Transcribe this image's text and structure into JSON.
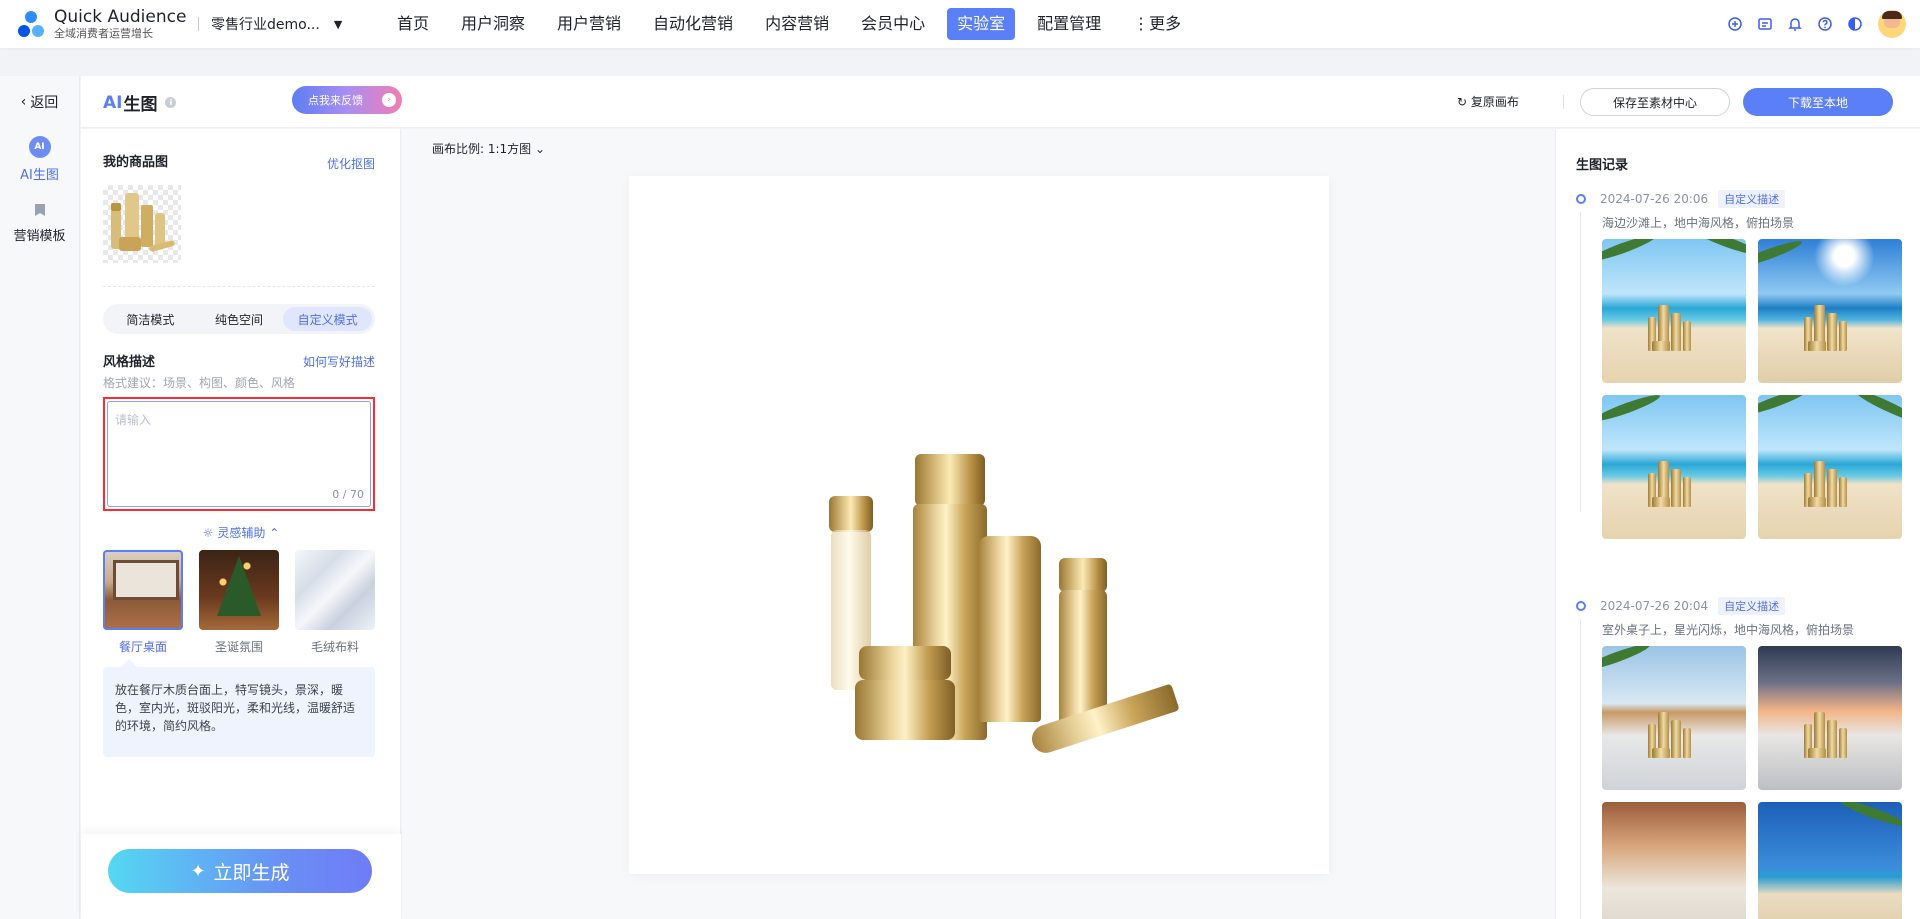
{
  "app": {
    "name": "Quick Audience",
    "tagline": "全域消费者运营增长",
    "workspace": "零售行业demo..."
  },
  "nav": {
    "items": [
      "首页",
      "用户洞察",
      "用户营销",
      "自动化营销",
      "内容营销",
      "会员中心",
      "实验室",
      "配置管理",
      "⋮更多"
    ],
    "active": "实验室"
  },
  "rail": {
    "back_label": "返回",
    "items": [
      {
        "label": "AI生图",
        "icon": "ai-icon",
        "icon_text": "AI",
        "active": true
      },
      {
        "label": "营销模板",
        "icon": "bookmark-icon",
        "active": false
      }
    ]
  },
  "header": {
    "title_ai": "AI",
    "title_rest": "生图",
    "feedback": "点我来反馈",
    "restore": "复原画布",
    "save": "保存至素材中心",
    "download": "下载至本地"
  },
  "panel": {
    "product_title": "我的商品图",
    "optimize_link": "优化抠图",
    "modes": [
      "简洁模式",
      "纯色空间",
      "自定义模式"
    ],
    "active_mode": "自定义模式",
    "style_title": "风格描述",
    "style_link": "如何写好描述",
    "hint": "格式建议：场景、构图、颜色、风格",
    "input_placeholder": "请输入",
    "counter": "0 / 70",
    "inspire": "灵感辅助",
    "style_cards": [
      {
        "label": "餐厅桌面",
        "active": true
      },
      {
        "label": "圣诞氛围",
        "active": false
      },
      {
        "label": "毛绒布料",
        "active": false
      }
    ],
    "style_desc": "放在餐厅木质台面上，特写镜头，景深，暖色，室内光，斑驳阳光，柔和光线，温暖舒适的环境，简约风格。",
    "generate": "立即生成"
  },
  "canvas": {
    "ratio_label": "画布比例: 1:1方图"
  },
  "history": {
    "title": "生图记录",
    "records": [
      {
        "time": "2024-07-26 20:06",
        "tag": "自定义描述",
        "desc": "海边沙滩上，地中海风格，俯拍场景"
      },
      {
        "time": "2024-07-26 20:04",
        "tag": "自定义描述",
        "desc": "室外桌子上，星光闪烁，地中海风格，俯拍场景"
      }
    ]
  },
  "colors": {
    "accent": "#5b7ff7",
    "highlight_border": "#ff2c2c"
  }
}
